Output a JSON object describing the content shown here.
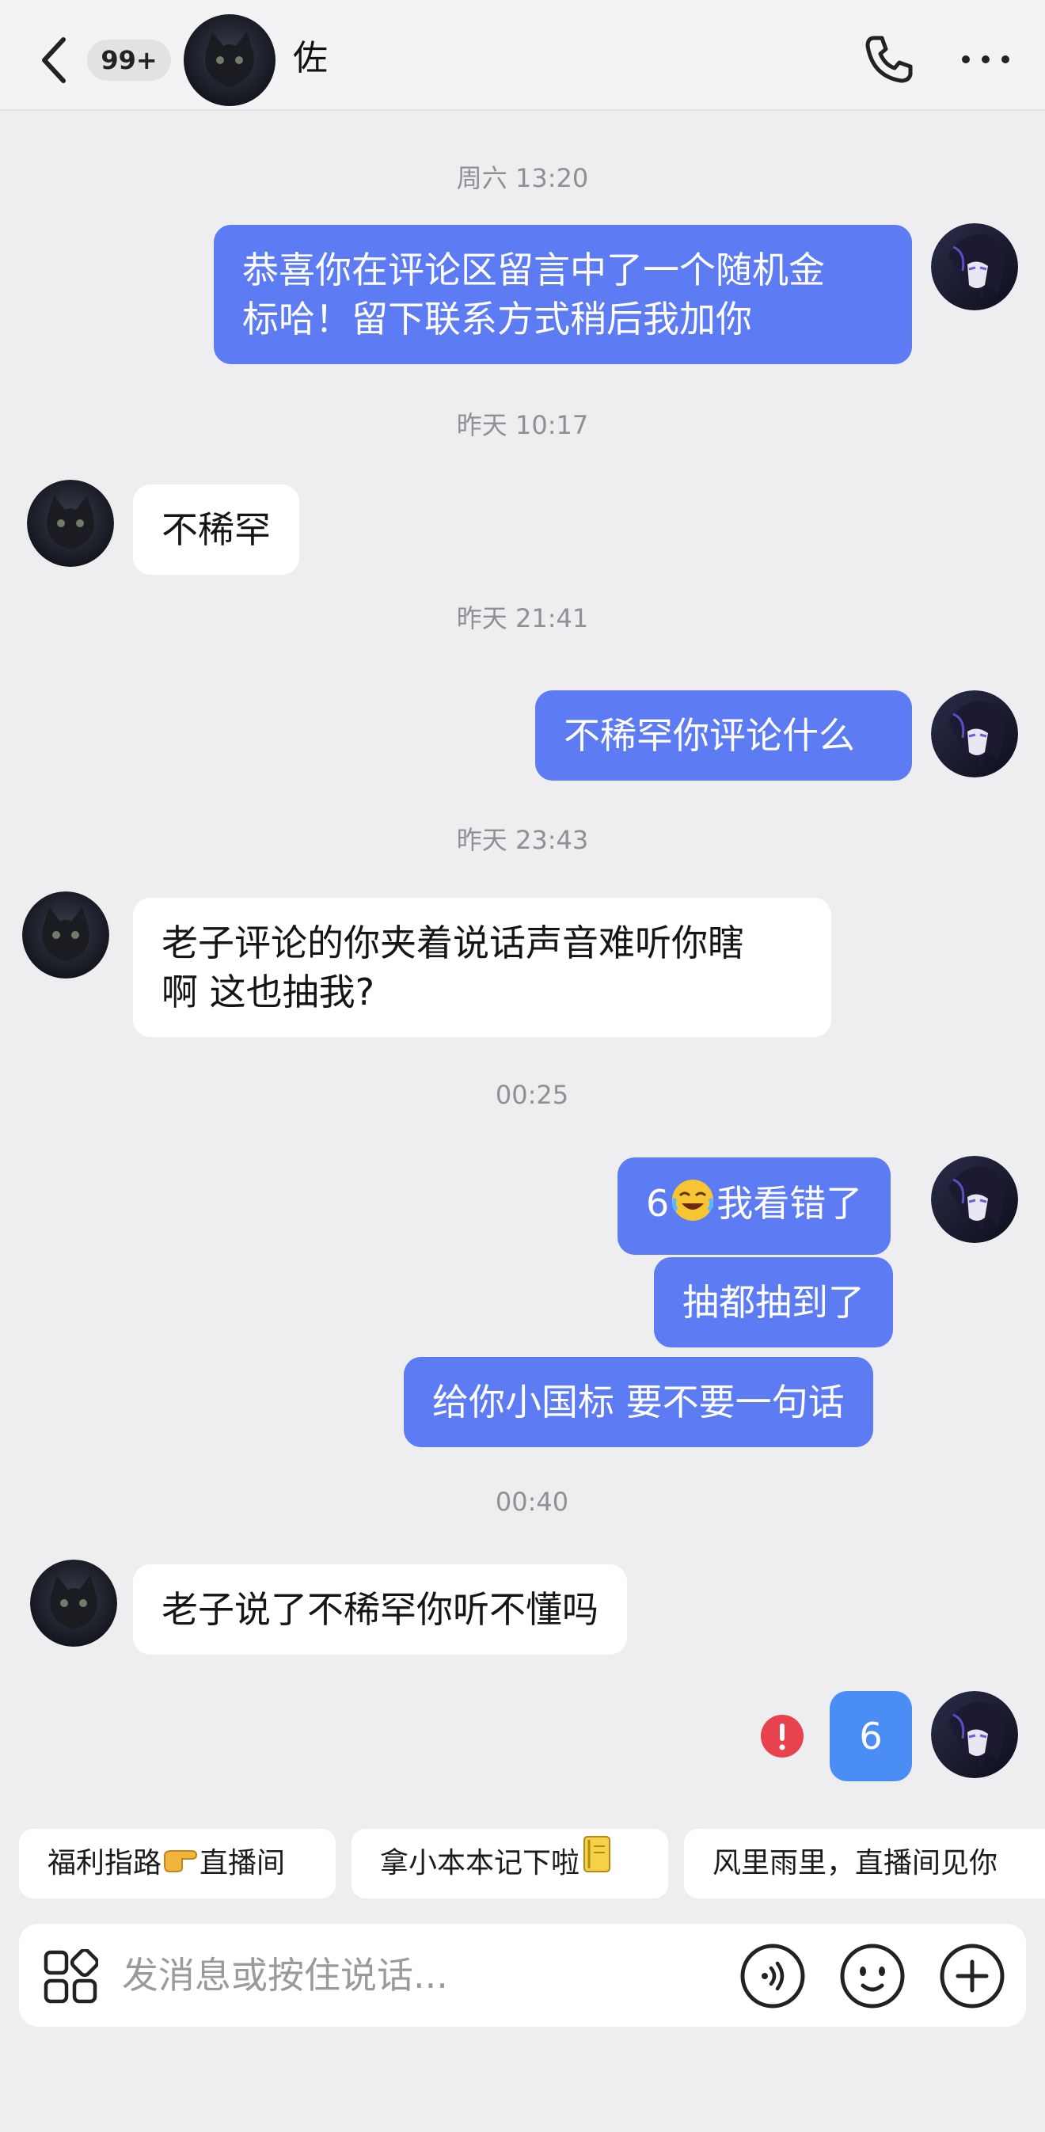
{
  "header": {
    "unread_badge": "99+",
    "contact_name": "佐",
    "icons": {
      "back": "chevron-left-icon",
      "call": "phone-icon",
      "more": "more-dots-icon"
    }
  },
  "messages": [
    {
      "type": "timestamp",
      "text": "周六 13:20"
    },
    {
      "type": "outgoing",
      "lines": [
        "恭喜你在评论区留言中了一个随机金",
        "标哈！留下联系方式稍后我加你"
      ]
    },
    {
      "type": "timestamp",
      "text": "昨天 10:17"
    },
    {
      "type": "incoming",
      "text": "不稀罕"
    },
    {
      "type": "timestamp",
      "text": "昨天 21:41"
    },
    {
      "type": "outgoing",
      "text": "不稀罕你评论什么"
    },
    {
      "type": "timestamp",
      "text": "昨天 23:43"
    },
    {
      "type": "incoming",
      "lines": [
        "老子评论的你夹着说话声音难听你瞎",
        "啊 这也抽我?"
      ]
    },
    {
      "type": "timestamp",
      "text": "00:25"
    },
    {
      "type": "outgoing",
      "parts": [
        "6",
        "我看错了"
      ],
      "emoji": "laughing-crying-emoji"
    },
    {
      "type": "outgoing",
      "text": "抽都抽到了"
    },
    {
      "type": "outgoing",
      "text": "给你小国标 要不要一句话"
    },
    {
      "type": "timestamp",
      "text": "00:40"
    },
    {
      "type": "incoming",
      "text": "老子说了不稀罕你听不懂吗"
    },
    {
      "type": "outgoing",
      "text": "6",
      "status": "failed"
    }
  ],
  "quick_replies": [
    {
      "before": "福利指路",
      "emoji": "pointing-right-emoji",
      "after": "直播间"
    },
    {
      "before": "拿小本本记下啦",
      "emoji": "notebook-emoji",
      "after": ""
    },
    {
      "before": "风里雨里，直播间见你",
      "emoji": "",
      "after": ""
    }
  ],
  "input": {
    "placeholder": "发消息或按住说话...",
    "value": ""
  },
  "colors": {
    "outgoing_bubble": "#5d7cf4",
    "failed_bubble": "#4a8ef5",
    "incoming_bubble": "#ffffff",
    "background": "#eeeef0",
    "error": "#e8424f"
  }
}
